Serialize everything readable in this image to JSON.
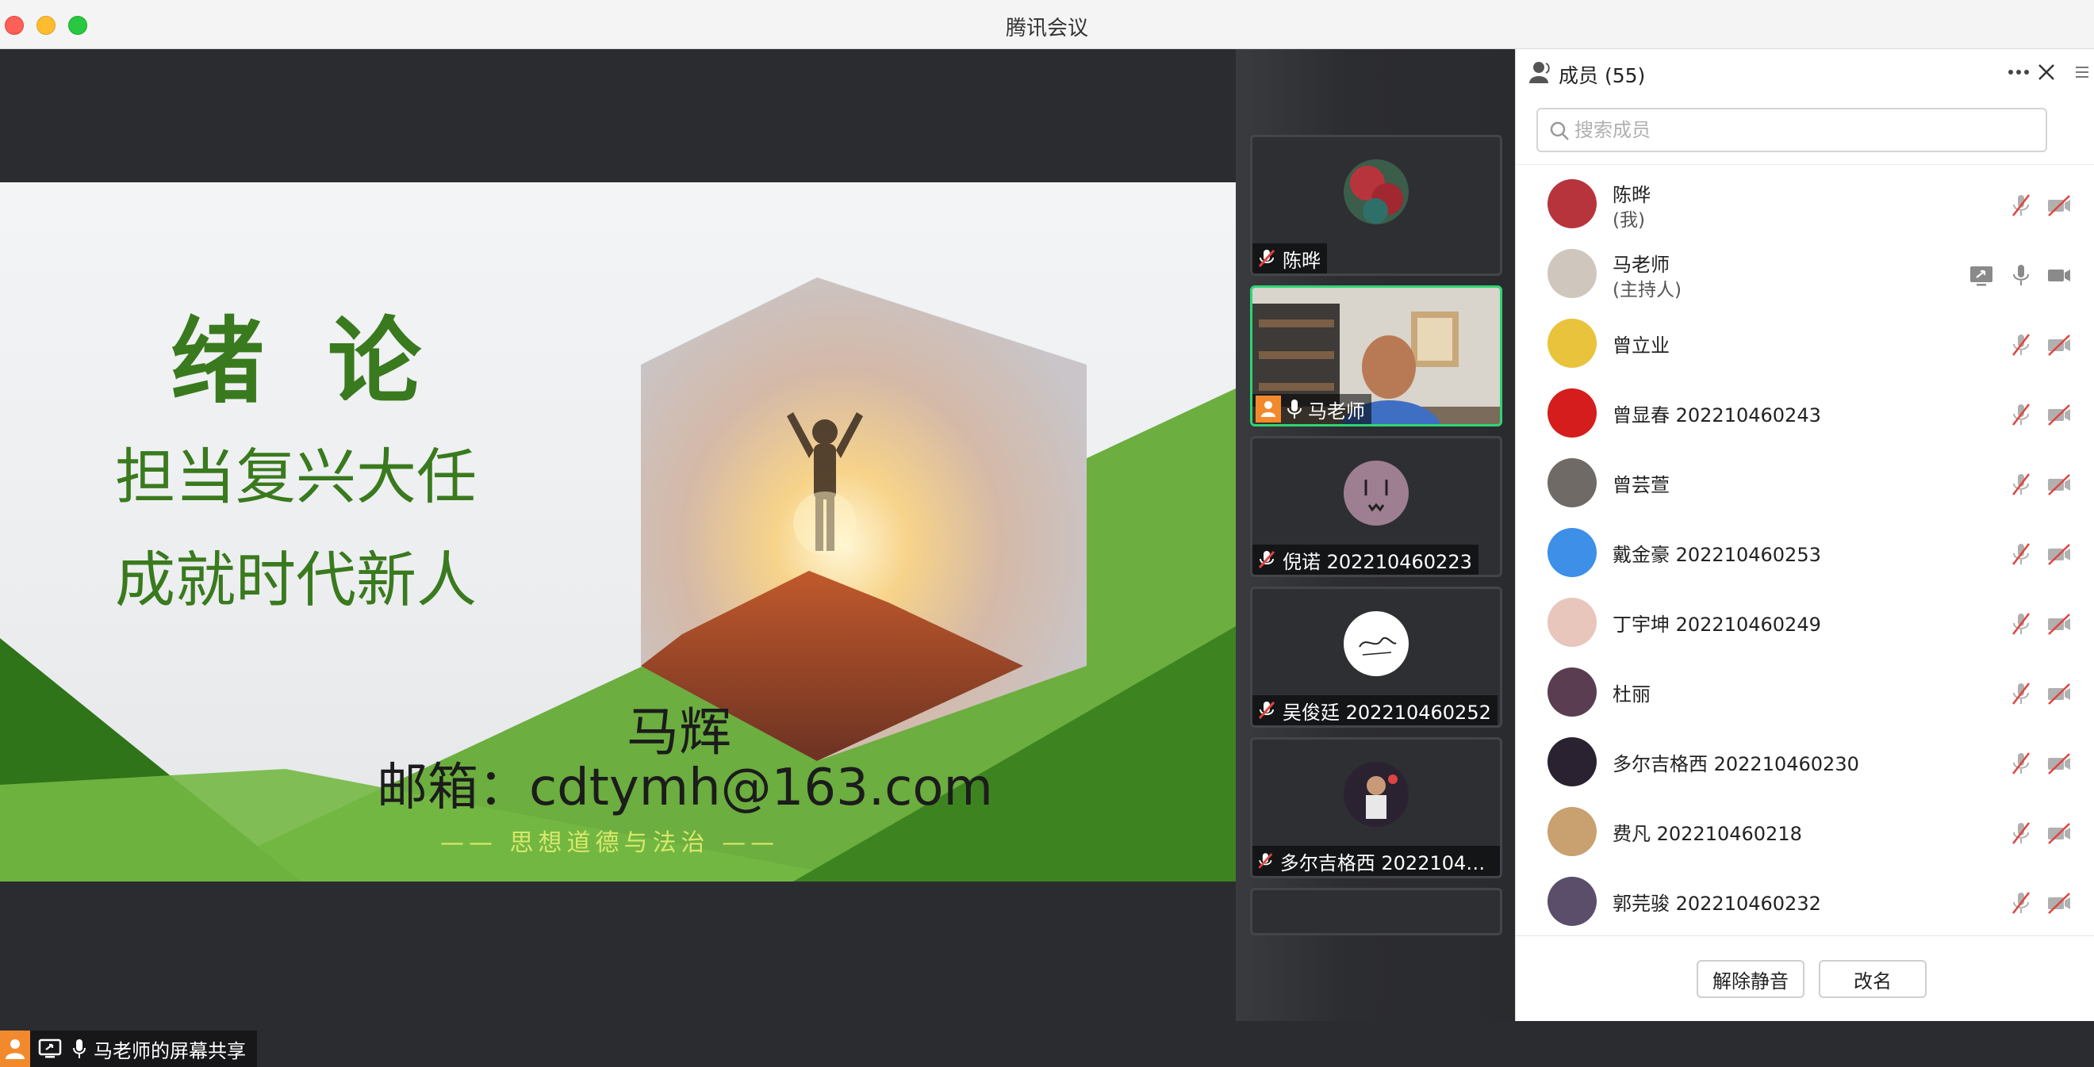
{
  "app": {
    "title": "腾讯会议"
  },
  "slide": {
    "title": "绪论",
    "line1": "担当复兴大任",
    "line2": "成就时代新人",
    "presenter": "马辉",
    "email": "邮箱：cdtymh@163.com",
    "course": "—— 思想道德与法治 ——"
  },
  "share_label": "马老师的屏幕共享",
  "video_tiles": [
    {
      "name": "陈晔",
      "mic": "muted",
      "active": false
    },
    {
      "name": "马老师",
      "mic": "on",
      "active": true
    },
    {
      "name": "倪诺 202210460223",
      "mic": "muted",
      "active": false
    },
    {
      "name": "吴俊廷 202210460252",
      "mic": "muted",
      "active": false
    },
    {
      "name": "多尔吉格西 2022104602…",
      "mic": "muted",
      "active": false
    }
  ],
  "panel": {
    "title": "成员 (55)",
    "search_placeholder": "搜索成员",
    "members": [
      {
        "name": "陈晔",
        "role": "(我)",
        "mic": "muted",
        "cam": "off",
        "avatar_color": "#b8343c"
      },
      {
        "name": "马老师",
        "role": "(主持人)",
        "mic": "on",
        "cam": "on",
        "sharing": true,
        "avatar_color": "#cfc7bd"
      },
      {
        "name": "曾立业",
        "mic": "muted",
        "cam": "off",
        "avatar_color": "#e9c33b"
      },
      {
        "name": "曾显春 202210460243",
        "mic": "muted",
        "cam": "off",
        "avatar_color": "#d61d1d"
      },
      {
        "name": "曾芸萱",
        "mic": "muted",
        "cam": "off",
        "avatar_color": "#6f6a66"
      },
      {
        "name": "戴金豪 202210460253",
        "mic": "muted",
        "cam": "off",
        "avatar_color": "#3d8fe8"
      },
      {
        "name": "丁宇坤 202210460249",
        "mic": "muted",
        "cam": "off",
        "avatar_color": "#e8c6bc"
      },
      {
        "name": "杜丽",
        "mic": "muted",
        "cam": "off",
        "avatar_color": "#5b3d52"
      },
      {
        "name": "多尔吉格西 202210460230",
        "mic": "muted",
        "cam": "off",
        "avatar_color": "#2a2230"
      },
      {
        "name": "费凡 202210460218",
        "mic": "muted",
        "cam": "off",
        "avatar_color": "#c9a070"
      },
      {
        "name": "郭芫骏 202210460232",
        "mic": "muted",
        "cam": "off",
        "avatar_color": "#5a4e6a"
      }
    ],
    "unmute_label": "解除静音",
    "rename_label": "改名"
  },
  "colors": {
    "accent_green": "#2ed573",
    "slide_green": "#3a7a1e",
    "muted_red": "#e0443e"
  }
}
